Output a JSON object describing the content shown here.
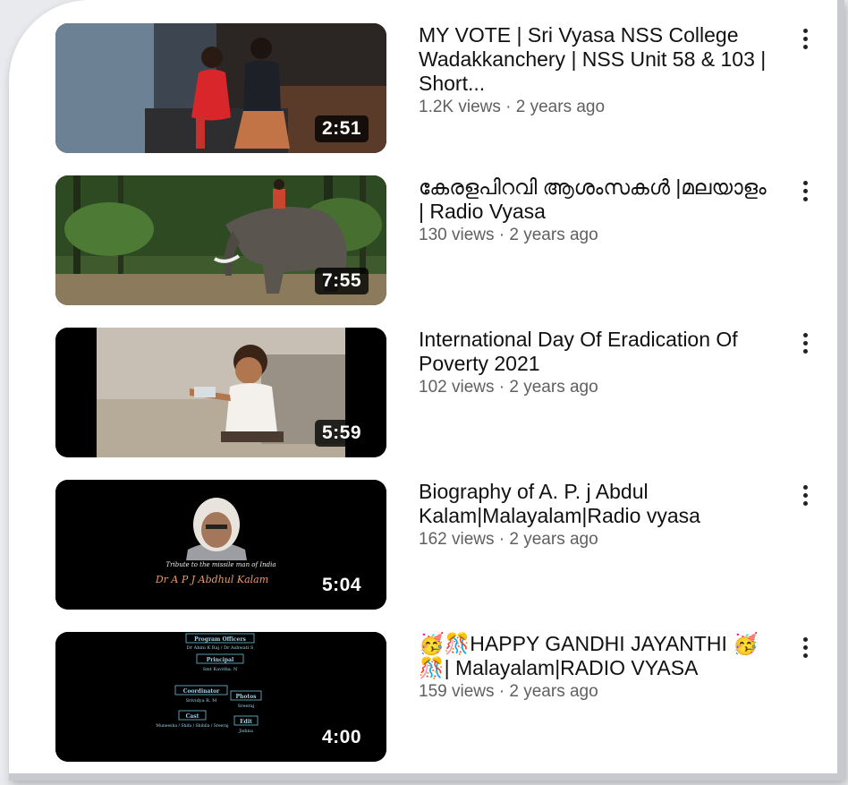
{
  "videos": [
    {
      "title": "MY VOTE  | Sri Vyasa NSS College Wadakkanchery | NSS Unit 58 & 103 | Short...",
      "views": "1.2K views",
      "age": "2 years ago",
      "duration": "2:51",
      "thumbnail": "two-people-sitting-scene"
    },
    {
      "title": "കേരളപിറവി ആശംസകൾ |മലയാളം | Radio Vyasa",
      "views": "130 views",
      "age": "2 years ago",
      "duration": "7:55",
      "thumbnail": "elephant-forest-scene"
    },
    {
      "title": "International Day Of Eradication Of Poverty 2021",
      "views": "102 views",
      "age": "2 years ago",
      "duration": "5:59",
      "thumbnail": "child-on-sand-scene"
    },
    {
      "title": "Biography of A. P. j Abdul Kalam|Malayalam|Radio vyasa",
      "views": "162 views",
      "age": "2 years ago",
      "duration": "5:04",
      "thumbnail": "portrait-tribute-card",
      "thumb_text": {
        "tribute": "Tribute to the missile man of India",
        "name": "Dr A P J Abdhul Kalam"
      }
    },
    {
      "title_parts": [
        "🥳🎊HAPPY GANDHI JAYANTHI",
        "🥳🎊| Malayalam|RADIO VYASA"
      ],
      "views": "159 views",
      "age": "2 years ago",
      "duration": "4:00",
      "thumbnail": "credits-card",
      "thumb_text": {
        "h1": "Program Officers",
        "l1": "Dr Ahini K Raj / Dr Ashwati S",
        "h2": "Principal",
        "l2": "Smt Kavitha. N",
        "h3": "Coordinator",
        "l3": "Srividya R. M",
        "h4": "Photos",
        "l4": "Sreeraj",
        "h5": "Cast",
        "l5": "Muneesha / Shifa / Shibila / Sreeraj",
        "h6": "Edit",
        "l6": "Jishnu"
      }
    }
  ],
  "separator": " · "
}
